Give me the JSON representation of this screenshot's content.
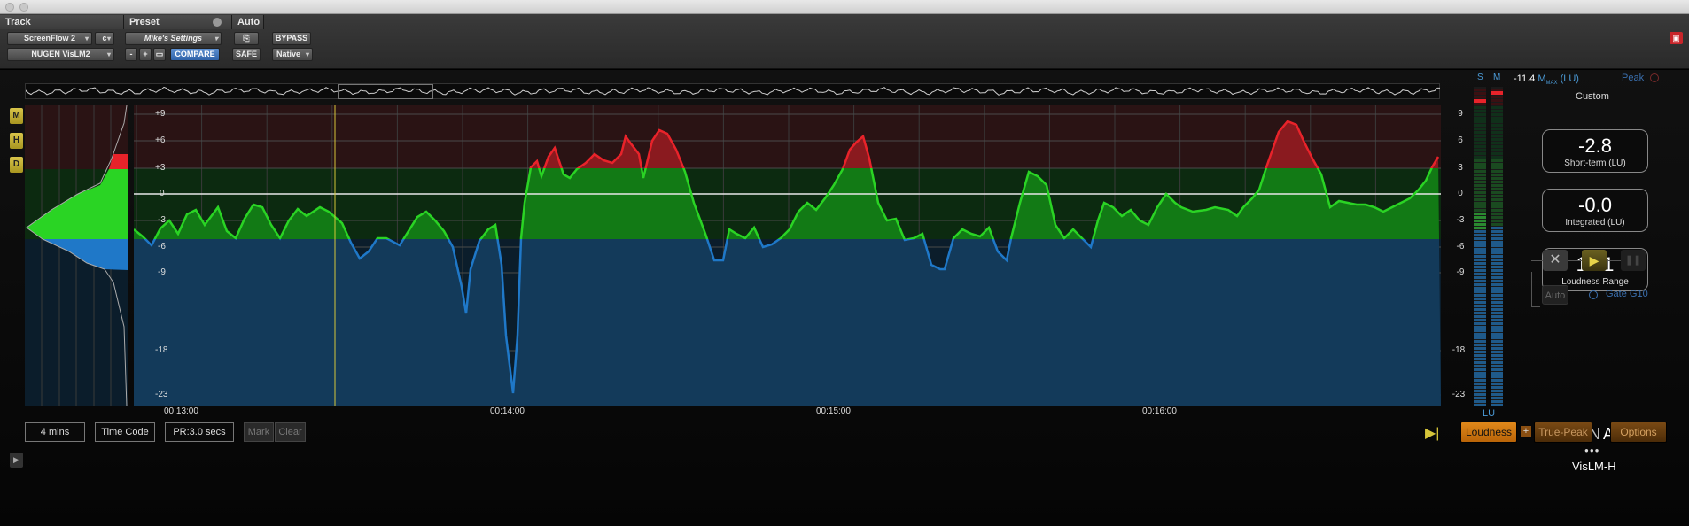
{
  "header": {
    "track_title": "Track",
    "preset_title": "Preset",
    "auto_title": "Auto",
    "track_name": "ScreenFlow 2",
    "track_channel": "c",
    "plugin_name": "NUGEN VisLM2",
    "preset_name": "Mike's Settings",
    "compare_label": "COMPARE",
    "minus_label": "-",
    "plus_label": "+",
    "safe_label": "SAFE",
    "bypass_label": "BYPASS",
    "native_label": "Native"
  },
  "side_buttons": [
    "M",
    "H",
    "D"
  ],
  "graph": {
    "y_labels": [
      "+9",
      "+6",
      "+3",
      "0",
      "-3",
      "-6",
      "-9",
      "-18",
      "-23"
    ],
    "x_labels": [
      "00:13:00",
      "00:14:00",
      "00:15:00",
      "00:16:00"
    ],
    "right_labels": [
      "9",
      "6",
      "3",
      "0",
      "-3",
      "-6",
      "-9",
      "-18",
      "-23"
    ],
    "colors": {
      "red": "#e8232a",
      "green": "#2ad424",
      "blue": "#1f78c8",
      "marker": "#d6c53a"
    }
  },
  "meters": {
    "s_label": "S",
    "m_label": "M",
    "unit_label": "LU"
  },
  "readouts": {
    "max_value": "-11.4",
    "max_m": "M",
    "max_sub": "MAX",
    "max_unit": "(LU)",
    "peak_label": "Peak",
    "mode_label": "Custom",
    "short_term": {
      "value": "-2.8",
      "label": "Short-term (LU)"
    },
    "integrated": {
      "value": "-0.0",
      "label": "Integrated (LU)"
    },
    "range": {
      "value": "13.1",
      "label": "Loudness Range"
    }
  },
  "controls": {
    "auto_label": "Auto",
    "gate_label": "Gate G10",
    "close_glyph": "✕",
    "play_glyph": "▶",
    "pause_glyph": "❚❚"
  },
  "brand": {
    "name_nu": "NU",
    "name_gen": "GEN",
    "name_audio": " Audio",
    "product": "VisLM-H"
  },
  "footer": {
    "time_span": "4 mins",
    "time_code": "Time Code",
    "pr_label": "PR:3.0 secs",
    "mark_label": "Mark",
    "clear_label": "Clear",
    "loudness_label": "Loudness",
    "plus_label": "+",
    "true_peak_label": "True-Peak",
    "options_label": "Options"
  }
}
